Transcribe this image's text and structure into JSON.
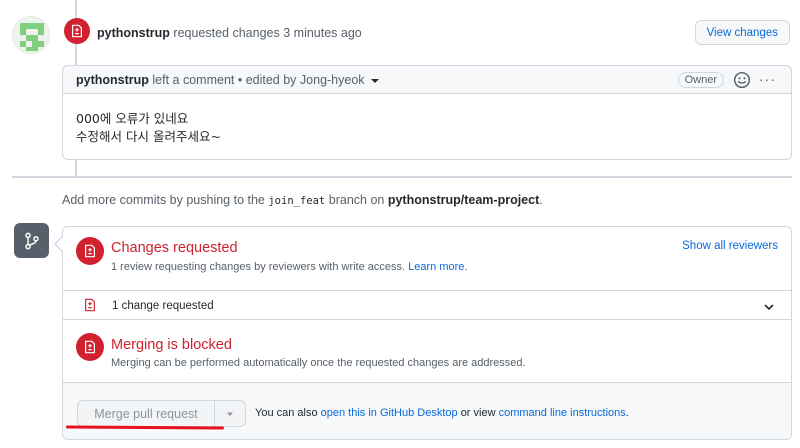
{
  "review": {
    "author": "pythonstrup",
    "action": "requested changes",
    "time": "3 minutes ago",
    "view_changes_label": "View changes"
  },
  "comment": {
    "author": "pythonstrup",
    "meta": "left a comment • edited by Jong-hyeok",
    "owner_badge": "Owner",
    "more_label": "···",
    "body_line1": "000에 오류가 있네요",
    "body_line2": "수정해서 다시 올려주세요~"
  },
  "push_hint": {
    "prefix": "Add more commits by pushing to the",
    "branch": "join_feat",
    "middle": "branch on",
    "repo": "pythonstrup/team-project",
    "suffix": "."
  },
  "merge_box": {
    "changes_title": "Changes requested",
    "changes_desc": "1 review requesting changes by reviewers with write access.",
    "learn_more": "Learn more.",
    "show_reviewers": "Show all reviewers",
    "change_row": "1 change requested",
    "blocked_title": "Merging is blocked",
    "blocked_desc": "Merging can be performed automatically once the requested changes are addressed.",
    "merge_button": "Merge pull request",
    "footer_prefix": "You can also",
    "footer_link1": "open this in GitHub Desktop",
    "footer_middle": "or view",
    "footer_link2": "command line instructions",
    "footer_suffix": "."
  },
  "icons": {
    "review": "file-diff-icon",
    "merge": "git-branch-icon",
    "emoji": "smiley-icon",
    "chevron": "chevron-down-icon",
    "caret": "caret-down-icon"
  },
  "colors": {
    "danger": "#cf222e",
    "link": "#0969da",
    "muted": "#57606a",
    "annotation": "#e5121f"
  }
}
